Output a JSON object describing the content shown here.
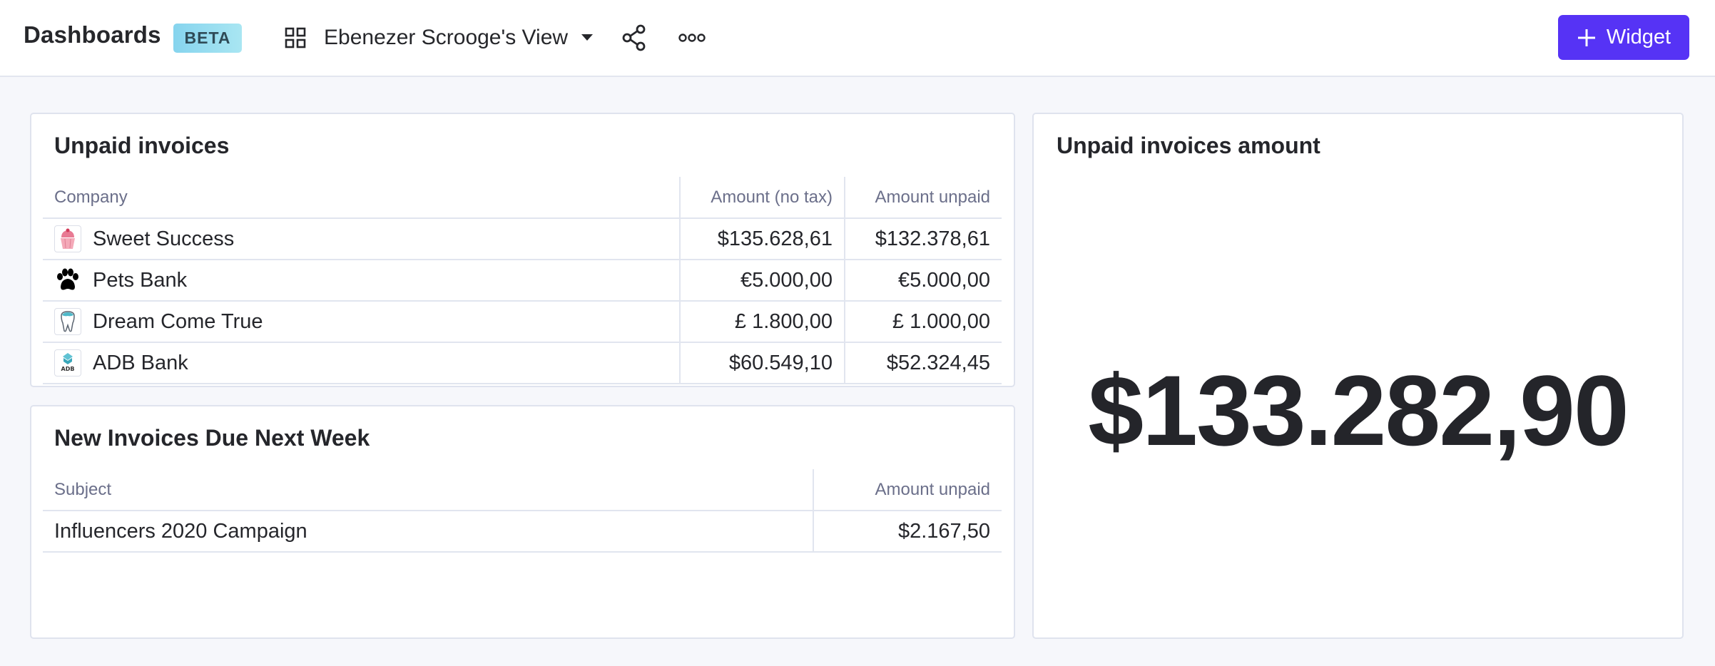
{
  "header": {
    "title": "Dashboards",
    "badge": "BETA",
    "view_name": "Ebenezer Scrooge's View",
    "widget_button": "Widget"
  },
  "unpaid_invoices": {
    "title": "Unpaid invoices",
    "columns": [
      "Company",
      "Amount (no tax)",
      "Amount unpaid"
    ],
    "rows": [
      {
        "company": "Sweet Success",
        "logo": "cupcake-icon",
        "amount_no_tax": "$135.628,61",
        "amount_unpaid": "$132.378,61"
      },
      {
        "company": "Pets Bank",
        "logo": "paw-icon",
        "amount_no_tax": "€5.000,00",
        "amount_unpaid": "€5.000,00"
      },
      {
        "company": "Dream Come True",
        "logo": "tooth-icon",
        "amount_no_tax": "£ 1.800,00",
        "amount_unpaid": "£ 1.000,00"
      },
      {
        "company": "ADB Bank",
        "logo": "adb-bank-logo",
        "logo_text": "ADB",
        "amount_no_tax": "$60.549,10",
        "amount_unpaid": "$52.324,45"
      }
    ]
  },
  "due_next_week": {
    "title": "New Invoices Due Next Week",
    "columns": [
      "Subject",
      "Amount unpaid"
    ],
    "rows": [
      {
        "subject": "Influencers 2020 Campaign",
        "amount_unpaid": "$2.167,50"
      }
    ]
  },
  "unpaid_amount": {
    "title": "Unpaid invoices amount",
    "value": "$133.282,90"
  },
  "colors": {
    "accent": "#5633f5",
    "badge_start": "#86d4ee",
    "badge_end": "#a9e6f2"
  }
}
